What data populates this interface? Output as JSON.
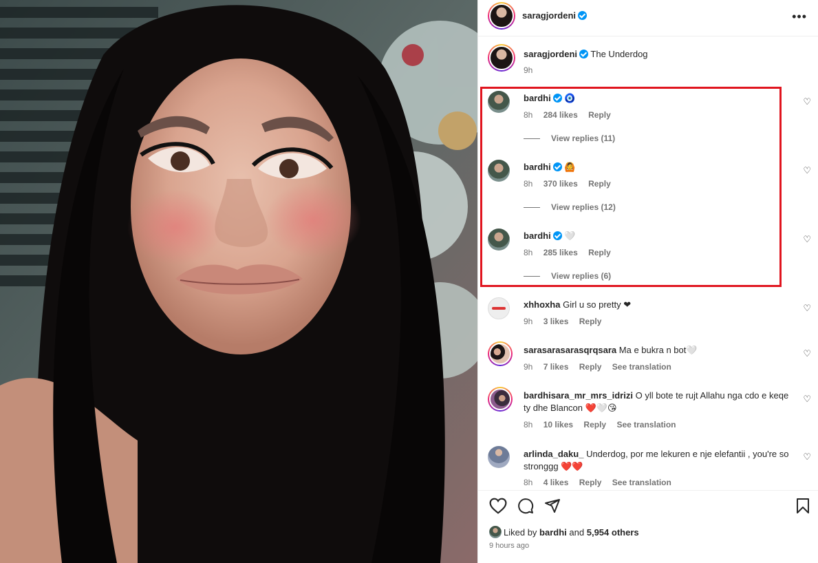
{
  "post": {
    "author": "saragjordeni",
    "caption": "The Underdog",
    "caption_time": "9h",
    "more_icon": "more-options-icon"
  },
  "comments": [
    {
      "user": "bardhi",
      "text": "🧿",
      "time": "8h",
      "likes": "284 likes",
      "reply": "Reply",
      "view_replies": "View replies (11)"
    },
    {
      "user": "bardhi",
      "text": "🙆",
      "time": "8h",
      "likes": "370 likes",
      "reply": "Reply",
      "view_replies": "View replies (12)"
    },
    {
      "user": "bardhi",
      "text": "🤍",
      "time": "8h",
      "likes": "285 likes",
      "reply": "Reply",
      "view_replies": "View replies (6)"
    },
    {
      "user": "xhhoxha",
      "text": "Girl u so pretty ❤",
      "time": "9h",
      "likes": "3 likes",
      "reply": "Reply"
    },
    {
      "user": "sarasarasarasqrqsara",
      "text": "Ma e bukra n bot🤍",
      "time": "9h",
      "likes": "7 likes",
      "reply": "Reply",
      "translate": "See translation"
    },
    {
      "user": "bardhisara_mr_mrs_idrizi",
      "text": "O yll bote te rujt Allahu nga cdo e keqe ty dhe Blancon ❤️🤍😘",
      "time": "8h",
      "likes": "10 likes",
      "reply": "Reply",
      "translate": "See translation"
    },
    {
      "user": "arlinda_daku_",
      "text": "Underdog, por me lekuren e nje elefantii , you're so stronggg ❤️❤️",
      "time": "8h",
      "likes": "4 likes",
      "reply": "Reply",
      "translate": "See translation"
    }
  ],
  "footer": {
    "liked_by_prefix": "Liked by",
    "liked_by_user": "bardhi",
    "liked_by_and": "and",
    "liked_by_count": "5,954 others",
    "posted_time": "9 hours ago"
  },
  "colors": {
    "highlight": "#e0141e",
    "verified": "#0095f6"
  }
}
